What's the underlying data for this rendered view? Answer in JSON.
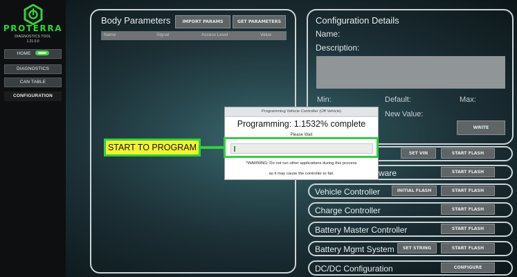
{
  "sidebar": {
    "brand": "PROTERRA",
    "subtitle": "DIAGNOSTICS TOOL",
    "version": "1.21.0.0",
    "items": [
      {
        "label": "HOME"
      },
      {
        "label": "DIAGNOSTICS"
      },
      {
        "label": "CAN TABLE"
      },
      {
        "label": "CONFIGURATION"
      }
    ],
    "toggle_on": true,
    "brand_color": "#2ed63a"
  },
  "body_params": {
    "title": "Body Parameters",
    "import_label": "IMPORT PARAMS",
    "get_label": "GET PARAMETERS",
    "columns": [
      "Name",
      "Signal",
      "Access Level",
      "Value"
    ]
  },
  "config": {
    "title": "Configuration Details",
    "name_label": "Name:",
    "description_label": "Description:",
    "min_label": "Min:",
    "default_label": "Default:",
    "max_label": "Max:",
    "new_value_label": "New Value:",
    "write_label": "WRITE"
  },
  "rows": [
    {
      "label": "",
      "mid_button": "SET VIN",
      "right_button": "START FLASH"
    },
    {
      "label": "ware",
      "mid_button": "",
      "right_button": "START FLASH"
    },
    {
      "label": "Vehicle Controller",
      "mid_button": "INITIAL FLASH",
      "right_button": "START FLASH"
    },
    {
      "label": "Charge Controller",
      "mid_button": "",
      "right_button": "START FLASH"
    },
    {
      "label": "Battery Master Controller",
      "mid_button": "",
      "right_button": "START FLASH"
    },
    {
      "label": "Battery Mgmt System",
      "mid_button": "SET STRING",
      "right_button": "START FLASH"
    },
    {
      "label": "DC/DC Configuration",
      "mid_button": "",
      "right_button": "CONFIGURE"
    }
  ],
  "dialog": {
    "title": "Programming Vehicle Controller (Off Vehicle)",
    "progress_text": "Programming: 1.1532% complete",
    "progress_percent": 1.1532,
    "wait_text": "Please Wait",
    "warning_line1": "*WARNING: Do not run other applications during this process",
    "warning_line2": "as it may cause the controller to fail."
  },
  "annotation": {
    "label": "START TO PROGRAM",
    "highlight_color": "#2fd13d",
    "fill_color": "#f2f32d"
  }
}
